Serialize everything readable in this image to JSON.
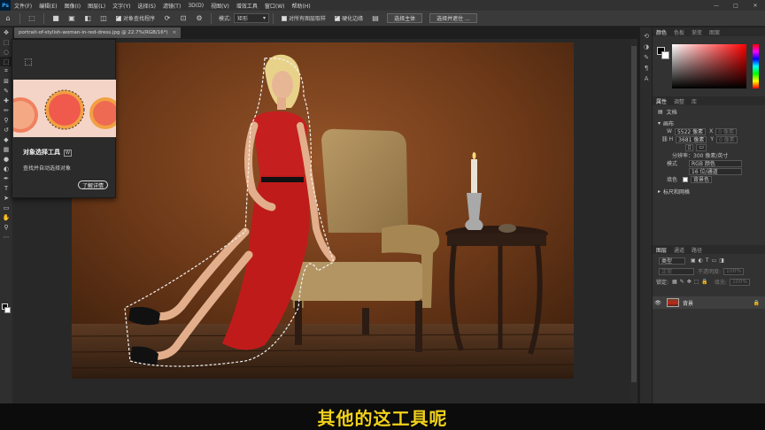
{
  "menubar": {
    "logo": "Ps",
    "items": [
      "文件(F)",
      "编辑(E)",
      "图像(I)",
      "图层(L)",
      "文字(Y)",
      "选择(S)",
      "滤镜(T)",
      "3D(D)",
      "视图(V)",
      "增效工具",
      "窗口(W)",
      "帮助(H)"
    ],
    "window_controls": [
      "—",
      "□",
      "✕"
    ]
  },
  "options": {
    "mode_label": "模式:",
    "mode_value": "矩形",
    "checkbox_object_finder": "对象查找程序",
    "checkbox_sample_all": "对所有图层取样",
    "checkbox_enhance_edge": "硬化边缘",
    "select_subject": "选择主体",
    "select_and_mask": "选择并遮住 ..."
  },
  "document": {
    "tab_title": "portrait-of-stylish-woman-in-red-dress.jpg @ 22.7%(RGB/16*)",
    "close": "×"
  },
  "tooltip": {
    "title": "对象选择工具",
    "shortcut": "W",
    "description": "查找并自动选择对象",
    "learn_more": "了解详情"
  },
  "panels": {
    "color_tabs": [
      "颜色",
      "色板",
      "渐变",
      "图案"
    ],
    "properties_tabs": [
      "属性",
      "调整",
      "库"
    ],
    "properties_doc": "文档",
    "canvas_section": "画布",
    "width_label": "W",
    "width_value": "5522 像素",
    "x_label": "X",
    "x_value": "0 像素",
    "height_label": "H",
    "height_value": "3681 像素",
    "y_label": "Y",
    "y_value": "0 像素",
    "resolution": "分辨率：300 像素/英寸",
    "mode_label": "模式",
    "mode_value": "RGB 颜色",
    "depth_value": "16 位/通道",
    "fill_label": "填色",
    "fill_value": "背景色",
    "rulers_section": "标尺和网格",
    "layers_tabs": [
      "图层",
      "通道",
      "路径"
    ],
    "kind_label": "类型",
    "blend_mode": "正常",
    "opacity_label": "不透明度:",
    "opacity_value": "100%",
    "lock_label": "锁定:",
    "fill2_label": "填充:",
    "fill2_value": "100%",
    "layer_name": "背景"
  },
  "subtitle": "其他的这工具呢",
  "colors": {
    "accent": "#31a8ff",
    "subtitle": "#f2d21b",
    "dress": "#c61f1f",
    "wall": "#7a4320"
  }
}
